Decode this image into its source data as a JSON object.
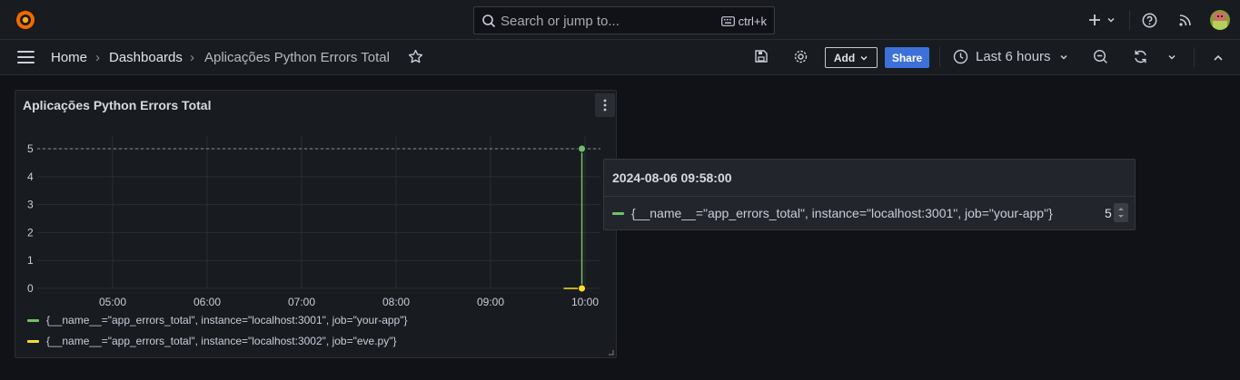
{
  "search": {
    "placeholder": "Search or jump to...",
    "shortcut": "ctrl+k"
  },
  "breadcrumb": {
    "home": "Home",
    "dashboards": "Dashboards",
    "current": "Aplicações Python Errors Total"
  },
  "toolbar": {
    "add_label": "Add",
    "share_label": "Share",
    "time_range": "Last 6 hours"
  },
  "panel": {
    "title": "Aplicações Python Errors Total"
  },
  "chart_data": {
    "type": "line",
    "x_ticks": [
      "05:00",
      "06:00",
      "07:00",
      "08:00",
      "09:00",
      "10:00"
    ],
    "y_ticks": [
      "0",
      "1",
      "2",
      "3",
      "4",
      "5"
    ],
    "ylim": [
      0,
      5
    ],
    "grid": true,
    "legend_placement": "bottom",
    "series": [
      {
        "name": "{__name__=\"app_errors_total\", instance=\"localhost:3001\", job=\"your-app\"}",
        "color": "#73bf69",
        "points": [
          [
            "09:58",
            0
          ],
          [
            "09:58",
            5
          ],
          [
            "10:00",
            5
          ]
        ]
      },
      {
        "name": "{__name__=\"app_errors_total\", instance=\"localhost:3002\", job=\"eve.py\"}",
        "color": "#fade2a",
        "points": [
          [
            "09:58",
            0
          ],
          [
            "10:00",
            0
          ]
        ]
      }
    ]
  },
  "tooltip": {
    "time": "2024-08-06 09:58:00",
    "label": "{__name__=\"app_errors_total\", instance=\"localhost:3001\", job=\"your-app\"}",
    "value": "5",
    "color": "#73bf69"
  }
}
